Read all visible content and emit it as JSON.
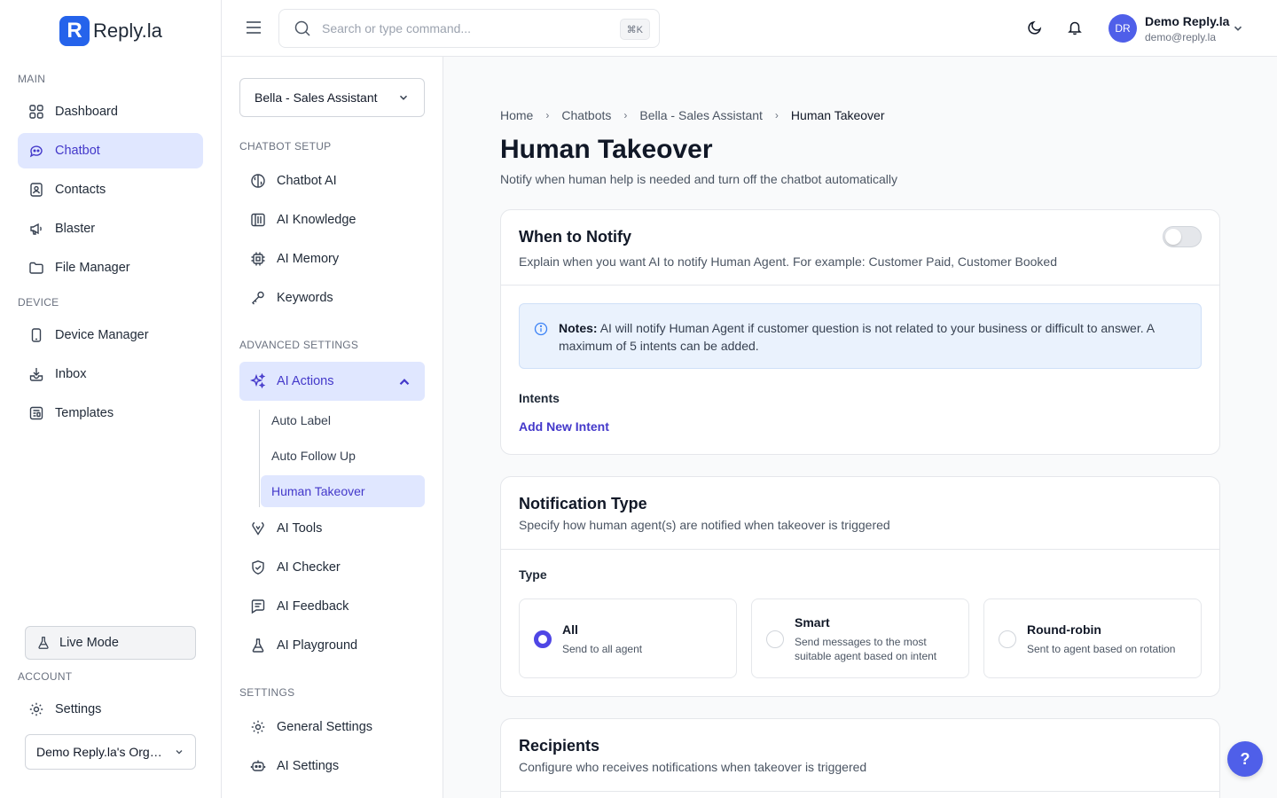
{
  "brand": {
    "logo_letter": "R",
    "name": "Reply.la"
  },
  "sidebar": {
    "main_label": "MAIN",
    "main_items": [
      {
        "label": "Dashboard",
        "icon": "grid-icon"
      },
      {
        "label": "Chatbot",
        "icon": "bot-icon",
        "active": true
      },
      {
        "label": "Contacts",
        "icon": "contact-icon"
      },
      {
        "label": "Blaster",
        "icon": "megaphone-icon"
      },
      {
        "label": "File Manager",
        "icon": "folder-icon"
      }
    ],
    "device_label": "DEVICE",
    "device_items": [
      {
        "label": "Device Manager",
        "icon": "phone-icon"
      },
      {
        "label": "Inbox",
        "icon": "inbox-icon"
      },
      {
        "label": "Templates",
        "icon": "template-icon"
      }
    ],
    "live_mode": "Live Mode",
    "account_label": "ACCOUNT",
    "settings": "Settings",
    "org": "Demo Reply.la's Organization"
  },
  "header": {
    "search_placeholder": "Search or type command...",
    "shortcut": "⌘K",
    "user_initials": "DR",
    "user_name": "Demo Reply.la",
    "user_email": "demo@reply.la"
  },
  "panel": {
    "bot_selected": "Bella - Sales Assistant",
    "setup_label": "CHATBOT SETUP",
    "setup_items": [
      "Chatbot AI",
      "AI Knowledge",
      "AI Memory",
      "Keywords"
    ],
    "advanced_label": "ADVANCED SETTINGS",
    "ai_actions": "AI Actions",
    "ai_actions_sub": [
      "Auto Label",
      "Auto Follow Up",
      "Human Takeover"
    ],
    "advanced_items": [
      "AI Tools",
      "AI Checker",
      "AI Feedback",
      "AI Playground"
    ],
    "settings_label": "SETTINGS",
    "settings_items": [
      "General Settings",
      "AI Settings"
    ]
  },
  "breadcrumb": [
    "Home",
    "Chatbots",
    "Bella - Sales Assistant",
    "Human Takeover"
  ],
  "page": {
    "title": "Human Takeover",
    "subtitle": "Notify when human help is needed and turn off the chatbot automatically"
  },
  "notify_card": {
    "title": "When to Notify",
    "desc": "Explain when you want AI to notify Human Agent. For example: Customer Paid, Customer Booked",
    "enabled": false,
    "note_bold": "Notes:",
    "note_text": "AI will notify Human Agent if customer question is not related to your business or difficult to answer. A maximum of 5 intents can be added.",
    "intents_label": "Intents",
    "add_intent": "Add New Intent"
  },
  "type_card": {
    "title": "Notification Type",
    "desc": "Specify how human agent(s) are notified when takeover is triggered",
    "type_label": "Type",
    "options": [
      {
        "name": "All",
        "desc": "Send to all agent",
        "selected": true
      },
      {
        "name": "Smart",
        "desc": "Send messages to the most suitable agent based on intent",
        "selected": false
      },
      {
        "name": "Round-robin",
        "desc": "Sent to agent based on rotation",
        "selected": false
      }
    ]
  },
  "recipients_card": {
    "title": "Recipients",
    "desc": "Configure who receives notifications when takeover is triggered"
  },
  "help": "?",
  "colors": {
    "accent": "#4f46e5",
    "active_bg": "#e0e7ff",
    "brand": "#2563eb"
  }
}
